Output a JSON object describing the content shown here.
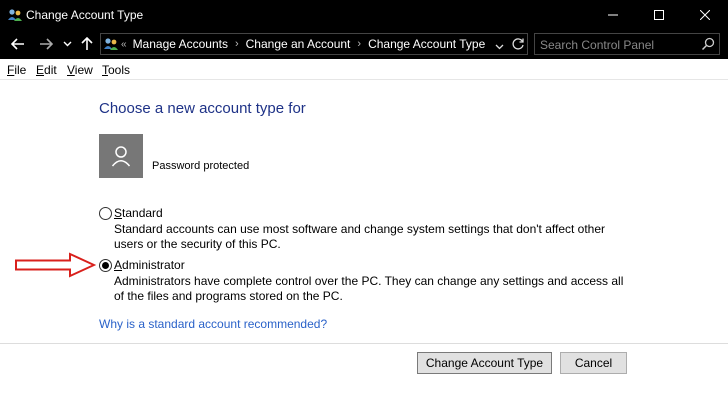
{
  "window": {
    "title": "Change Account Type"
  },
  "nav": {
    "breadcrumbs": [
      "Manage Accounts",
      "Change an Account",
      "Change Account Type"
    ],
    "search_placeholder": "Search Control Panel"
  },
  "menu": {
    "items": [
      {
        "label": "File",
        "key": "F",
        "rest": "ile"
      },
      {
        "label": "Edit",
        "key": "E",
        "rest": "dit"
      },
      {
        "label": "View",
        "key": "V",
        "rest": "iew"
      },
      {
        "label": "Tools",
        "key": "T",
        "rest": "ools"
      }
    ]
  },
  "main": {
    "heading": "Choose a new account type for",
    "account_status": "Password protected",
    "options": [
      {
        "key": "S",
        "rest": "tandard",
        "label": "Standard",
        "selected": false,
        "description": "Standard accounts can use most software and change system settings that don't affect other users or the security of this PC."
      },
      {
        "key": "A",
        "rest": "dministrator",
        "label": "Administrator",
        "selected": true,
        "description": "Administrators have complete control over the PC. They can change any settings and access all of the files and programs stored on the PC."
      }
    ],
    "help_link": "Why is a standard account recommended?",
    "confirm_button": "Change Account Type",
    "cancel_button": "Cancel"
  },
  "colors": {
    "heading": "#1e3287",
    "link": "#2a62c9",
    "arrow": "#d9201c"
  }
}
